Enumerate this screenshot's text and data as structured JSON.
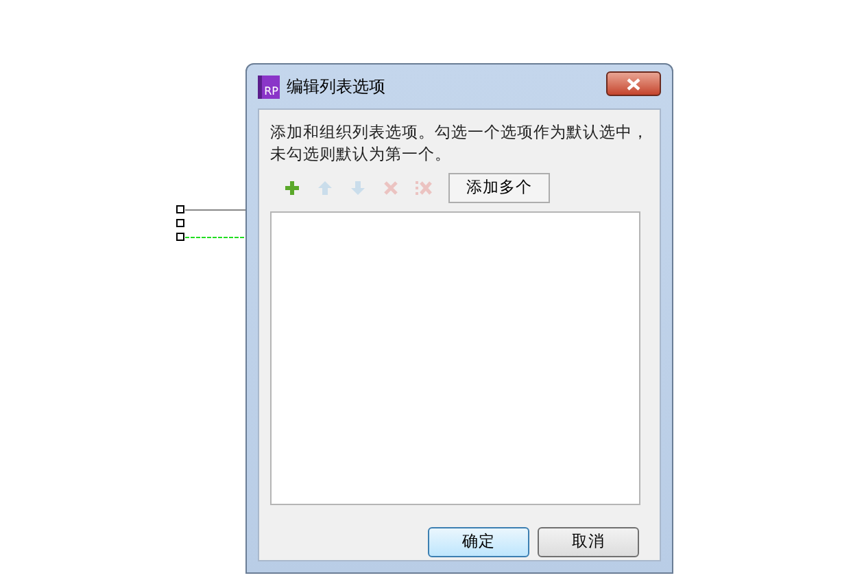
{
  "window": {
    "title": "编辑列表选项",
    "app_icon": "RP"
  },
  "description": "添加和组织列表选项。勾选一个选项作为默认选中，未勾选则默认为第一个。",
  "toolbar": [
    {
      "kind": "add",
      "disabled": false
    },
    {
      "kind": "up",
      "disabled": true
    },
    {
      "kind": "down",
      "disabled": true
    },
    {
      "kind": "delete",
      "disabled": true
    },
    {
      "kind": "delete_all",
      "disabled": true
    }
  ],
  "add_multiple_button": "添加多个",
  "buttons": [
    {
      "label": "确定",
      "default": true
    },
    {
      "label": "取消",
      "default": false
    }
  ]
}
